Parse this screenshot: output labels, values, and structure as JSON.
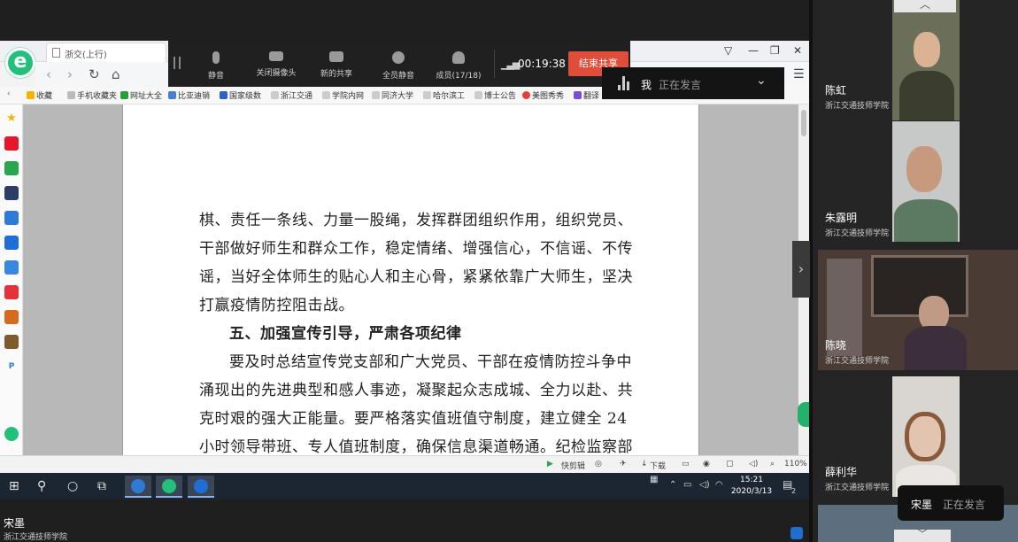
{
  "browser": {
    "tab_title": "浙交(上行)",
    "url_partial": "fi",
    "bookmarks": [
      "收藏",
      "手机收藏夹",
      "网址大全",
      "比亚迪销",
      "国家级数",
      "浙江交通",
      "学院内网",
      "同济大学",
      "哈尔滨工",
      "博士公告",
      "美图秀秀",
      "翻译"
    ],
    "status_items": [
      "快剪辑",
      "下载"
    ],
    "zoom": "110%"
  },
  "document": {
    "lines": [
      "棋、责任一条线、力量一股绳，发挥群团组织作用，组织党员、",
      "干部做好师生和群众工作，稳定情绪、增强信心，不信谣、不传",
      "谣，当好全体师生的贴心人和主心骨，紧紧依靠广大师生，坚决",
      "打赢疫情防控阻击战。",
      "五、加强宣传引导，严肃各项纪律",
      "要及时总结宣传党支部和广大党员、干部在疫情防控斗争中",
      "涌现出的先进典型和感人事迹，凝聚起众志成城、全力以赴、共",
      "克时艰的强大正能量。要严格落实值班值守制度，建立健全 24",
      "小时领导带班、专人值班制度，确保信息渠道畅通。纪检监察部"
    ]
  },
  "meeting_toolbar": {
    "mute": "静音",
    "camera_off": "关闭摄像头",
    "new_share": "新的共享",
    "mute_all": "全员静音",
    "members": "成员(17/18)",
    "elapsed": "00:19:38",
    "end_share": "结束共享"
  },
  "speaking_top": {
    "name": "我",
    "status": "正在发言"
  },
  "taskbar": {
    "time": "15:21",
    "date": "2020/3/13",
    "notif_count": "2"
  },
  "self_view": {
    "name": "宋墨",
    "org": "浙江交通技师学院"
  },
  "participants": [
    {
      "name": "陈虹",
      "org": "浙江交通技师学院"
    },
    {
      "name": "朱露明",
      "org": "浙江交通技师学院"
    },
    {
      "name": "陈晓",
      "org": "浙江交通技师学院"
    },
    {
      "name": "薛利华",
      "org": "浙江交通技师学院"
    }
  ],
  "speaking_bottom": {
    "name": "宋墨",
    "status": "正在发言"
  },
  "colors": {
    "end_button": "#e04d3a",
    "brand_green": "#22c07a",
    "taskbar": "#1c2633"
  }
}
